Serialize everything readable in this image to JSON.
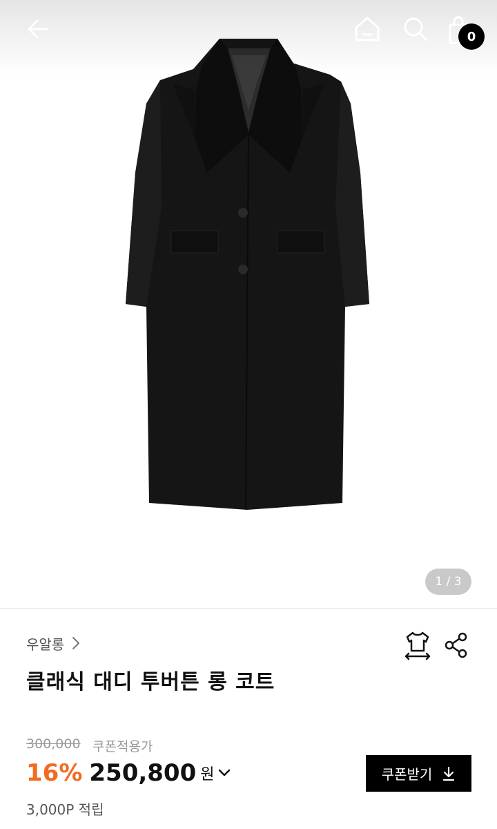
{
  "header": {
    "cart_count": "0"
  },
  "gallery": {
    "counter": "1 / 3"
  },
  "product": {
    "brand": "우알롱",
    "title": "클래식 대디 투버튼 롱 코트"
  },
  "pricing": {
    "original_price": "300,000",
    "coupon_price_label": "쿠폰적용가",
    "discount": "16%",
    "sale_price": "250,800",
    "currency": "원",
    "coupon_button": "쿠폰받기",
    "points": "3,000P 적립",
    "accent_color": "#f26b21"
  },
  "icons": [
    "back-arrow-icon",
    "home-icon",
    "search-icon",
    "shopping-bag-icon",
    "chevron-right-icon",
    "size-guide-icon",
    "share-icon",
    "chevron-down-icon",
    "download-icon"
  ]
}
